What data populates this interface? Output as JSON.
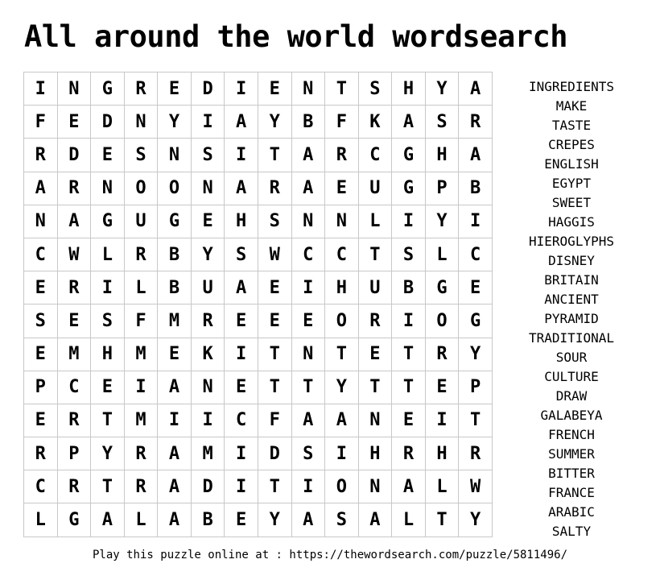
{
  "title": "All around the world wordsearch",
  "grid": [
    [
      "I",
      "N",
      "G",
      "R",
      "E",
      "D",
      "I",
      "E",
      "N",
      "T",
      "S",
      "H",
      "Y",
      "A"
    ],
    [
      "F",
      "E",
      "D",
      "N",
      "Y",
      "I",
      "A",
      "Y",
      "B",
      "F",
      "K",
      "A",
      "S",
      "R"
    ],
    [
      "R",
      "D",
      "E",
      "S",
      "N",
      "S",
      "I",
      "T",
      "A",
      "R",
      "C",
      "G",
      "H",
      "A"
    ],
    [
      "A",
      "R",
      "N",
      "O",
      "O",
      "N",
      "A",
      "R",
      "A",
      "E",
      "U",
      "G",
      "P",
      "B"
    ],
    [
      "N",
      "A",
      "G",
      "U",
      "G",
      "E",
      "H",
      "S",
      "N",
      "N",
      "L",
      "I",
      "Y",
      "I"
    ],
    [
      "C",
      "W",
      "L",
      "R",
      "B",
      "Y",
      "S",
      "W",
      "C",
      "C",
      "T",
      "S",
      "L",
      "C"
    ],
    [
      "E",
      "R",
      "I",
      "L",
      "B",
      "U",
      "A",
      "E",
      "I",
      "H",
      "U",
      "B",
      "G",
      "E"
    ],
    [
      "S",
      "E",
      "S",
      "F",
      "M",
      "R",
      "E",
      "E",
      "E",
      "O",
      "R",
      "I",
      "O",
      "G"
    ],
    [
      "E",
      "M",
      "H",
      "M",
      "E",
      "K",
      "I",
      "T",
      "N",
      "T",
      "E",
      "T",
      "R",
      "Y"
    ],
    [
      "P",
      "C",
      "E",
      "I",
      "A",
      "N",
      "E",
      "T",
      "T",
      "Y",
      "T",
      "T",
      "E",
      "P"
    ],
    [
      "E",
      "R",
      "T",
      "M",
      "I",
      "I",
      "C",
      "F",
      "A",
      "A",
      "N",
      "E",
      "I",
      "T"
    ],
    [
      "R",
      "P",
      "Y",
      "R",
      "A",
      "M",
      "I",
      "D",
      "S",
      "I",
      "H",
      "R",
      "H",
      "R"
    ],
    [
      "C",
      "R",
      "T",
      "R",
      "A",
      "D",
      "I",
      "T",
      "I",
      "O",
      "N",
      "A",
      "L",
      "W"
    ],
    [
      "L",
      "G",
      "A",
      "L",
      "A",
      "B",
      "E",
      "Y",
      "A",
      "S",
      "A",
      "L",
      "T",
      "Y"
    ]
  ],
  "words": [
    "INGREDIENTS",
    "MAKE",
    "TASTE",
    "CREPES",
    "ENGLISH",
    "EGYPT",
    "SWEET",
    "HAGGIS",
    "HIEROGLYPHS",
    "DISNEY",
    "BRITAIN",
    "ANCIENT",
    "PYRAMID",
    "TRADITIONAL",
    "SOUR",
    "CULTURE",
    "DRAW",
    "GALABEYA",
    "FRENCH",
    "SUMMER",
    "BITTER",
    "FRANCE",
    "ARABIC",
    "SALTY"
  ],
  "footer": "Play this puzzle online at : https://thewordsearch.com/puzzle/5811496/"
}
